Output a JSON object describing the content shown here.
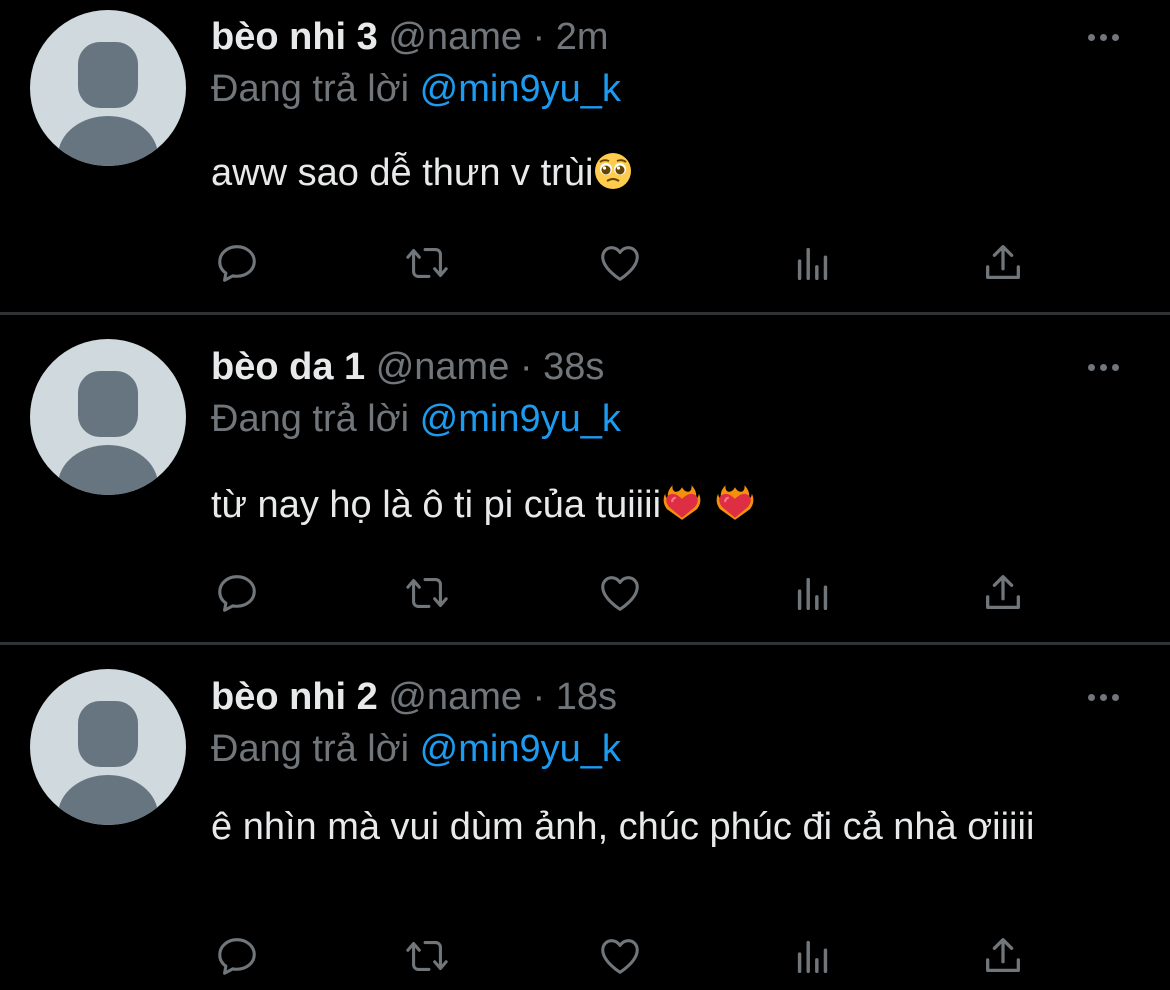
{
  "colors": {
    "background": "#000000",
    "divider": "#2f3336",
    "text_primary": "#e7e9ea",
    "text_secondary": "#71767b",
    "link": "#1d9bf0",
    "avatar_bg": "#cfd9de",
    "avatar_fg": "#66757f"
  },
  "tweets": [
    {
      "display_name": "bèo nhi 3",
      "handle": "@name",
      "separator": " · ",
      "time": "2m",
      "reply_prefix": "Đang trả lời ",
      "reply_to": "@min9yu_k",
      "text": "aww sao dễ thưn v trùi",
      "emoji": [
        "pleading-face-emoji"
      ],
      "icons": [
        "reply-icon",
        "retweet-icon",
        "like-icon",
        "views-icon",
        "share-icon",
        "more-icon"
      ]
    },
    {
      "display_name": "bèo da 1",
      "handle": "@name",
      "separator": " · ",
      "time": "38s",
      "reply_prefix": "Đang trả lời ",
      "reply_to": "@min9yu_k",
      "text": "từ nay họ là ô ti pi của tuiiii",
      "emoji": [
        "heart-on-fire-emoji",
        "heart-on-fire-emoji"
      ],
      "icons": [
        "reply-icon",
        "retweet-icon",
        "like-icon",
        "views-icon",
        "share-icon",
        "more-icon"
      ]
    },
    {
      "display_name": "bèo nhi 2",
      "handle": "@name",
      "separator": " · ",
      "time": "18s",
      "reply_prefix": "Đang trả lời ",
      "reply_to": "@min9yu_k",
      "text": "ê nhìn mà vui dùm ảnh, chúc phúc đi cả nhà ơiiiii",
      "emoji": [],
      "icons": [
        "reply-icon",
        "retweet-icon",
        "like-icon",
        "views-icon",
        "share-icon",
        "more-icon"
      ]
    }
  ]
}
